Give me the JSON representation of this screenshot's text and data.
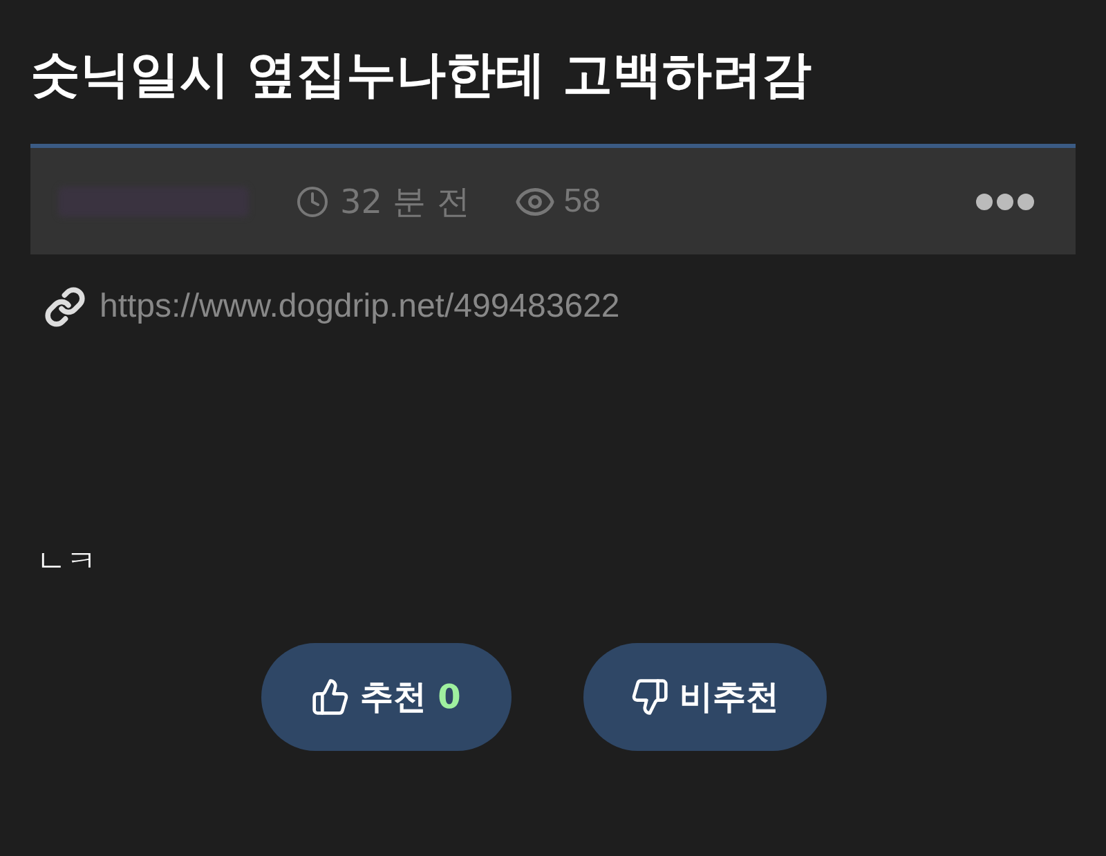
{
  "title": "숫닉일시 옆집누나한테 고백하려감",
  "meta": {
    "time": "32 분 전",
    "views": "58"
  },
  "link": "https://www.dogdrip.net/499483622",
  "body": "ㄴㅋ",
  "vote": {
    "up_label": "추천",
    "up_count": "0",
    "down_label": "비추천"
  }
}
